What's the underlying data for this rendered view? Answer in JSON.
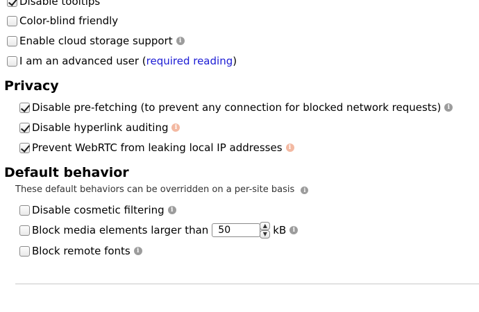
{
  "appearance": {
    "disable_tooltips": {
      "label": "Disable tooltips",
      "checked": true
    },
    "color_blind": {
      "label": "Color-blind friendly",
      "checked": false
    },
    "cloud_storage": {
      "label": "Enable cloud storage support",
      "checked": false
    },
    "advanced_user": {
      "label_prefix": "I am an advanced user (",
      "link_text": "required reading",
      "label_suffix": ")",
      "checked": false
    }
  },
  "privacy": {
    "heading": "Privacy",
    "prefetching": {
      "label": "Disable pre-fetching (to prevent any connection for blocked network requests)",
      "checked": true
    },
    "hyperlink_auditing": {
      "label": "Disable hyperlink auditing",
      "checked": true
    },
    "webrtc": {
      "label": "Prevent WebRTC from leaking local IP addresses",
      "checked": true
    }
  },
  "default_behavior": {
    "heading": "Default behavior",
    "note": "These default behaviors can be overridden on a per-site basis",
    "cosmetic": {
      "label": "Disable cosmetic filtering",
      "checked": false
    },
    "media": {
      "label": "Block media elements larger than",
      "value": "50",
      "unit": "kB",
      "checked": false
    },
    "fonts": {
      "label": "Block remote fonts",
      "checked": false
    }
  },
  "icons": {
    "info": "i",
    "spin_up": "▲",
    "spin_down": "▼"
  },
  "colors": {
    "link": "#1a1ad4",
    "info_gray": "#9c9c9c",
    "info_warn": "#f3b9a2"
  }
}
